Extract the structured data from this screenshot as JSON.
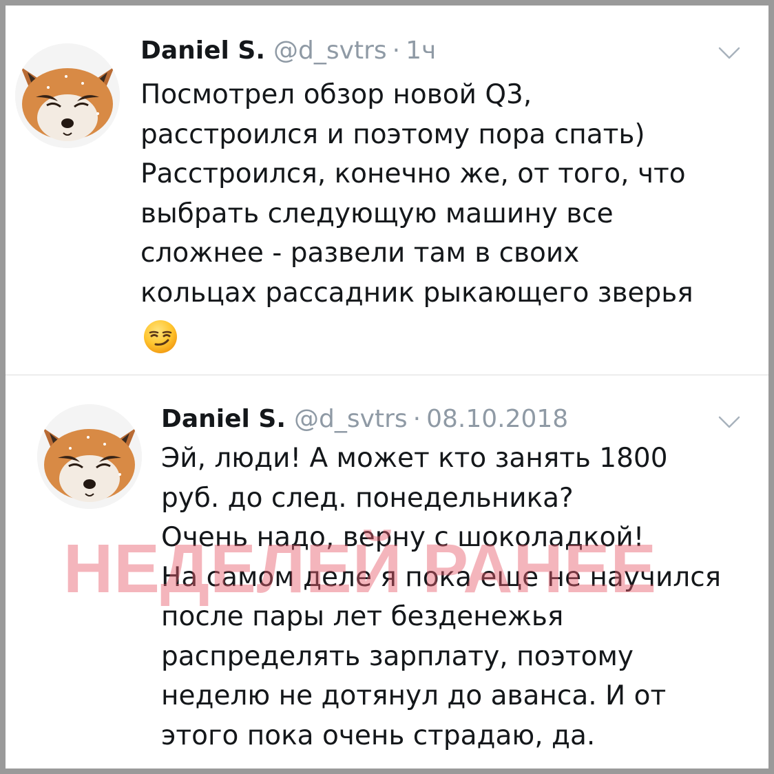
{
  "tweets": [
    {
      "author_name": "Daniel S.",
      "handle": "@d_svtrs",
      "separator": "·",
      "time": "1ч",
      "text_lines": [
        "Посмотрел обзор новой Q3,",
        "расстроился и поэтому пора спать)",
        "Расстроился, конечно же, от того, что",
        "выбрать следующую машину все",
        "сложнее - развели там в своих",
        "кольцах рассадник рыкающего зверья"
      ],
      "emoji": "smirking-face"
    },
    {
      "author_name": "Daniel S.",
      "handle": "@d_svtrs",
      "separator": "·",
      "time": "08.10.2018",
      "text_lines": [
        "Эй, люди! А может кто занять 1800",
        "руб. до след. понедельника?",
        "Очень надо, верну с шоколадкой!",
        "На самом деле я пока еще не научился",
        "после пары лет безденежья",
        "распределять зарплату, поэтому",
        "неделю не дотянул до аванса. И от",
        "этого пока очень страдаю, да."
      ]
    }
  ],
  "watermark": "НЕДЕЛЕЙ РАНЕЕ",
  "colors": {
    "name": "#14171a",
    "meta": "#8f9aa5",
    "watermark": "#e85d6c",
    "frame_border": "#9a9a9a"
  }
}
